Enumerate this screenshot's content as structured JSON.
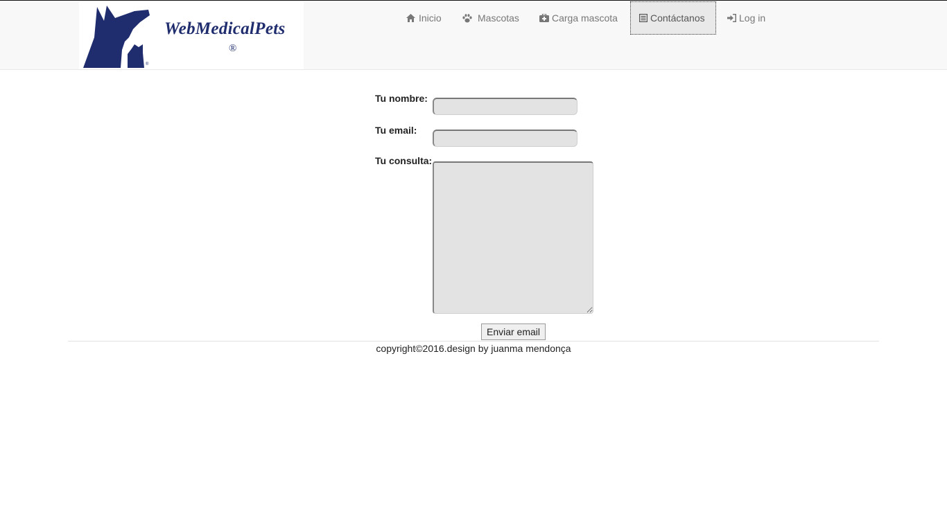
{
  "brand": {
    "name": "WebMedicalPets",
    "registered_mark": "®",
    "color": "#1f2d6e"
  },
  "nav": {
    "items": [
      {
        "label": "Inicio",
        "icon": "home-icon"
      },
      {
        "label": "Mascotas",
        "icon": "paw-icon"
      },
      {
        "label": "Carga mascota",
        "icon": "medkit-icon"
      },
      {
        "label": "Contáctanos",
        "icon": "list-alt-icon",
        "active": true
      },
      {
        "label": "Log in",
        "icon": "log-in-icon"
      }
    ]
  },
  "form": {
    "name_label": "Tu nombre:",
    "name_value": "",
    "email_label": "Tu email:",
    "email_value": "",
    "query_label": "Tu consulta:",
    "query_value": "",
    "submit_label": "Enviar email"
  },
  "footer": {
    "copyright": "copyright©2016.design by juanma mendonça"
  }
}
